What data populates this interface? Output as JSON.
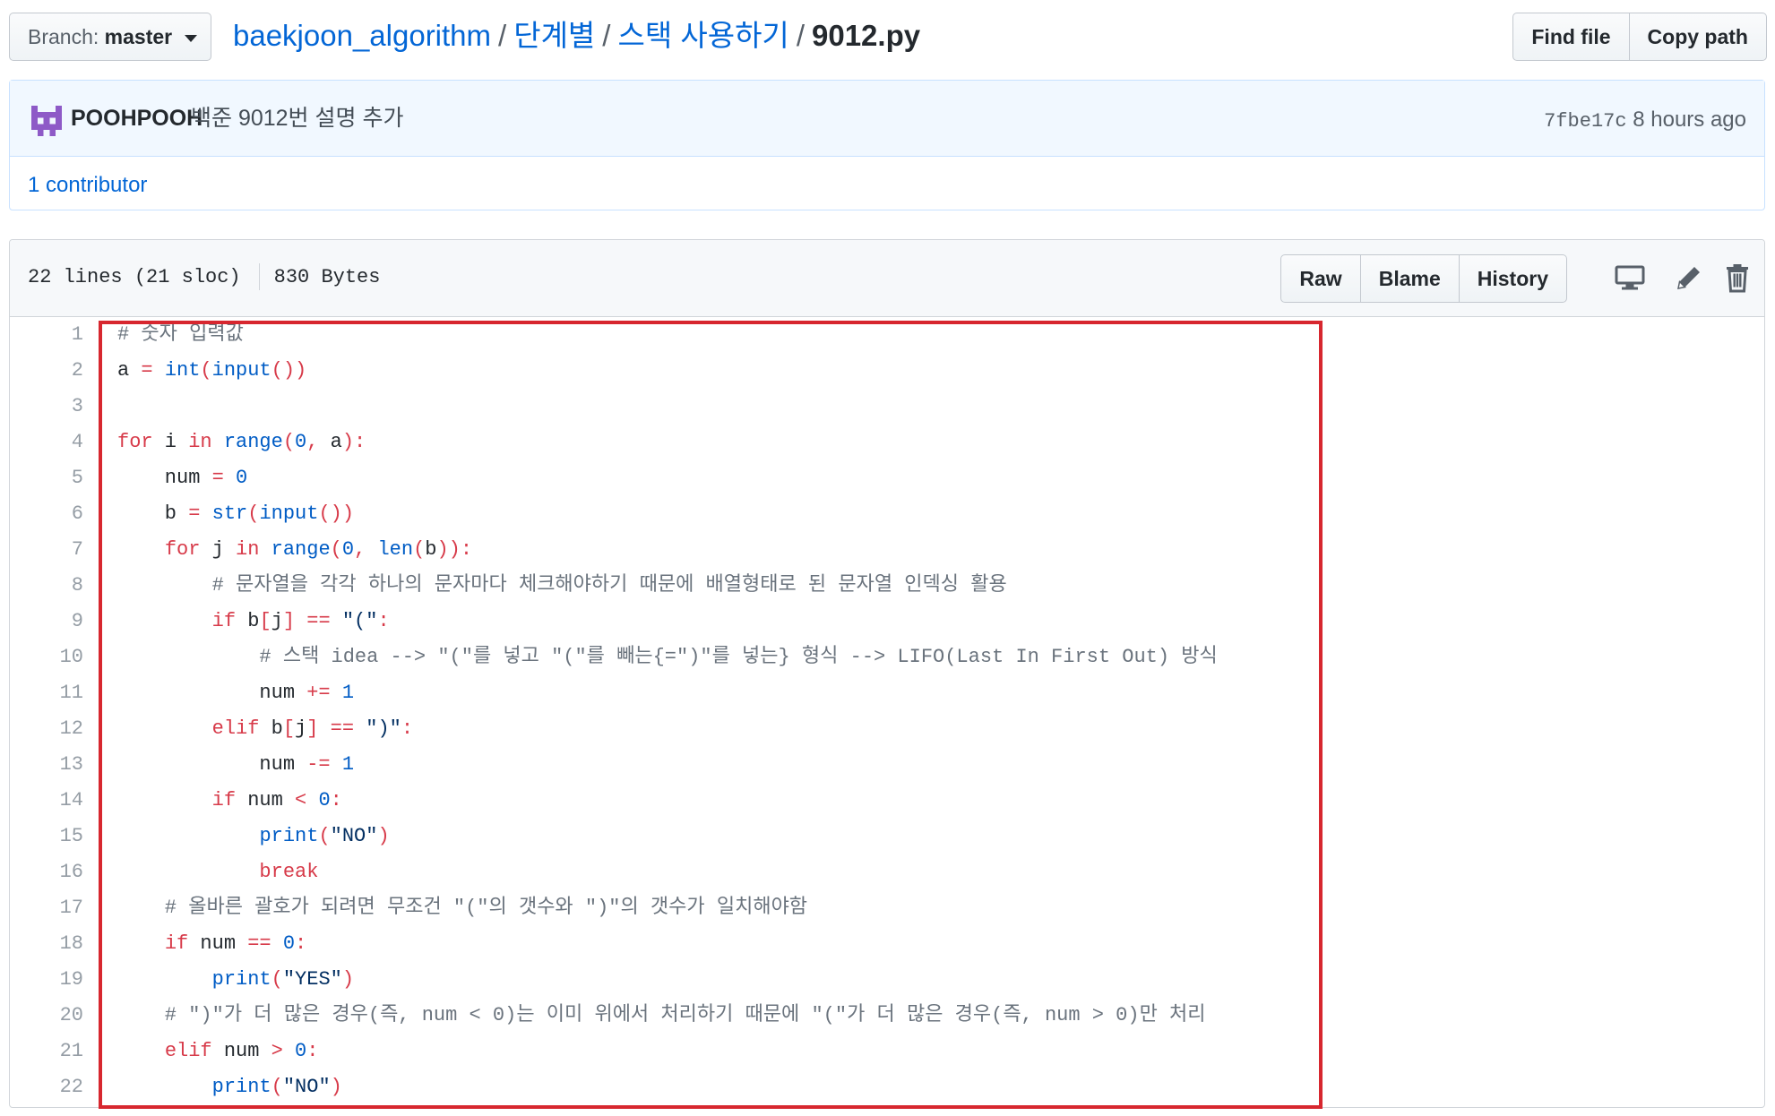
{
  "branch": {
    "label": "Branch:",
    "value": "master"
  },
  "breadcrumb": {
    "repo": "baekjoon_algorithm",
    "dir1": "단계별",
    "dir2": "스택 사용하기",
    "file": "9012.py",
    "sep": "/"
  },
  "header_actions": {
    "find_file": "Find file",
    "copy_path": "Copy path"
  },
  "commit": {
    "author": "POOHPOOH",
    "message": "백준 9012번 설명 추가",
    "sha": "7fbe17c",
    "time": "8 hours ago"
  },
  "contributors": "1 contributor",
  "file_info": {
    "lines": "22 lines (21 sloc)",
    "size": "830 Bytes"
  },
  "file_actions": {
    "raw": "Raw",
    "blame": "Blame",
    "history": "History"
  },
  "code_lines": [
    "# 숫자 입력값",
    "a = int(input())",
    "",
    "for i in range(0, a):",
    "    num = 0",
    "    b = str(input())",
    "    for j in range(0, len(b)):",
    "        # 문자열을 각각 하나의 문자마다 체크해야하기 때문에 배열형태로 된 문자열 인덱싱 활용",
    "        if b[j] == \"(\":",
    "            # 스택 idea --> \"(\"를 넣고 \"(\"를 빼는{=\")\"를 넣는} 형식 --> LIFO(Last In First Out) 방식",
    "            num += 1",
    "        elif b[j] == \")\":",
    "            num -= 1",
    "        if num < 0:",
    "            print(\"NO\")",
    "            break",
    "    # 올바른 괄호가 되려면 무조건 \"(\"의 갯수와 \")\"의 갯수가 일치해야함",
    "    if num == 0:",
    "        print(\"YES\")",
    "    # \")\"가 더 많은 경우(즉, num < 0)는 이미 위에서 처리하기 때문에 \"(\"가 더 많은 경우(즉, num > 0)만 처리",
    "    elif num > 0:",
    "        print(\"NO\")"
  ],
  "colors": {
    "link": "#0366d6",
    "keyword": "#d73a49",
    "builtin": "#005cc5",
    "comment": "#6a737d",
    "highlight_frame": "#d7272f"
  },
  "icons": {
    "avatar": "identicon-avatar",
    "display": "desktop-icon",
    "edit": "pencil-icon",
    "delete": "trash-icon"
  }
}
